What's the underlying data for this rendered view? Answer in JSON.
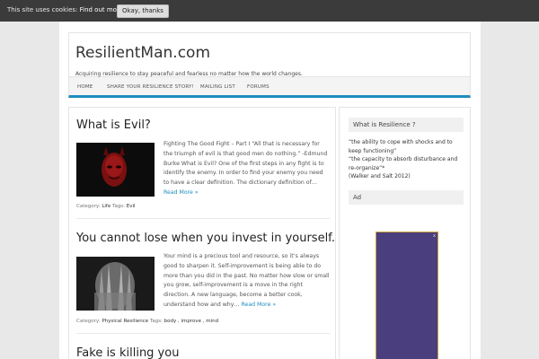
{
  "cookie_bar": {
    "text": "This site uses cookies: ",
    "link": "Find out more.",
    "button": "Okay, thanks"
  },
  "header": {
    "site_title": "ResilientMan.com",
    "tagline": "Acquiring resilience to stay peaceful and fearless no matter how the world changes."
  },
  "nav": {
    "items": [
      {
        "label": "HOME"
      },
      {
        "label": "SHARE YOUR RESILIENCE STORY!"
      },
      {
        "label": "MAILING LIST"
      },
      {
        "label": "FORUMS"
      }
    ]
  },
  "posts": [
    {
      "title": "What is Evil?",
      "excerpt": "Fighting The Good Fight – Part I “All that is necessary for the triumph of evil is that good men do nothing.” -Edmund Burke What is Evil? One of the first steps in any fight is to identify the enemy. In order to find your enemy you need to have a clear definition. The dictionary definition of… ",
      "more": "Read More »",
      "category_label": "Category:",
      "category": "Life",
      "tags_label": "Tags:",
      "tags": "Evil"
    },
    {
      "title": "You cannot lose when you invest in yourself.",
      "excerpt": "Your mind is a precious tool and resource, so it’s always good to sharpen it. Self-improvement is being able to do more than you did in the past. No matter how slow or small you grow, self-improvement is a move in the right direction. A new language, become a better cook, understand how and why… ",
      "more": "Read More »",
      "category_label": "Category:",
      "category": "Physical Resilience",
      "tags_label": "Tags:",
      "tags": "body , improve , mind"
    },
    {
      "title": "Fake is killing you"
    }
  ],
  "sidebar": {
    "widget1_title": "What is Resilience ?",
    "widget1_line1": "“the ability to cope with shocks and to keep functioning”",
    "widget1_line2": "“the capacity to absorb disturbance and re-organize”*",
    "widget1_line3": "(Walker and Salt 2012)",
    "widget2_title": "Ad",
    "ad_close": "x"
  },
  "colors": {
    "accent": "#1e8cbe",
    "cookie_bar": "#3b3b3b",
    "ad_background": "#4b3e7e"
  }
}
